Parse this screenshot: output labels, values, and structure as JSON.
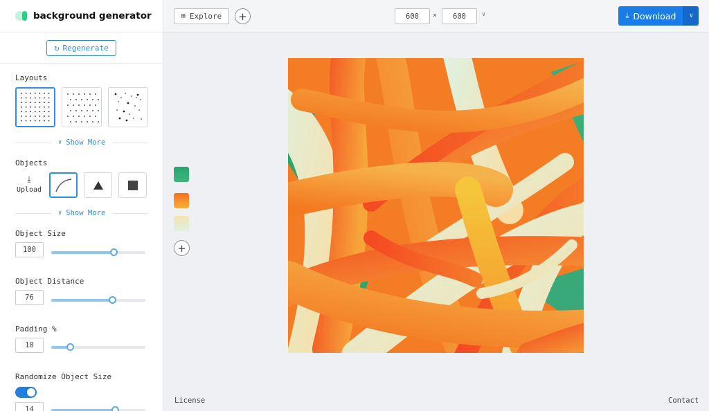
{
  "app": {
    "name": "background generator"
  },
  "sidebar": {
    "regenerate_label": "Regenerate",
    "layouts": {
      "label": "Layouts",
      "show_more": "Show More",
      "options": [
        "grid",
        "offset-grid",
        "random"
      ],
      "selected": 0
    },
    "objects": {
      "label": "Objects",
      "upload_label": "Upload",
      "show_more": "Show More",
      "options": [
        "curve",
        "triangle",
        "square"
      ],
      "selected": 0
    },
    "object_size": {
      "label": "Object Size",
      "value": "100",
      "level": 0.66
    },
    "object_distance": {
      "label": "Object Distance",
      "value": "76",
      "level": 0.65
    },
    "padding": {
      "label": "Padding %",
      "value": "10",
      "level": 0.2
    },
    "randomize": {
      "label": "Randomize Object Size",
      "enabled": true,
      "value": "14",
      "level": 0.68
    }
  },
  "toolbar": {
    "explore_label": "Explore",
    "width": "600",
    "height": "600",
    "times": "×",
    "download_label": "Download"
  },
  "palette": {
    "colors": [
      "#2eaa70",
      "#f25a24",
      "#f3e0b0"
    ]
  },
  "footer": {
    "license": "License",
    "contact": "Contact"
  }
}
